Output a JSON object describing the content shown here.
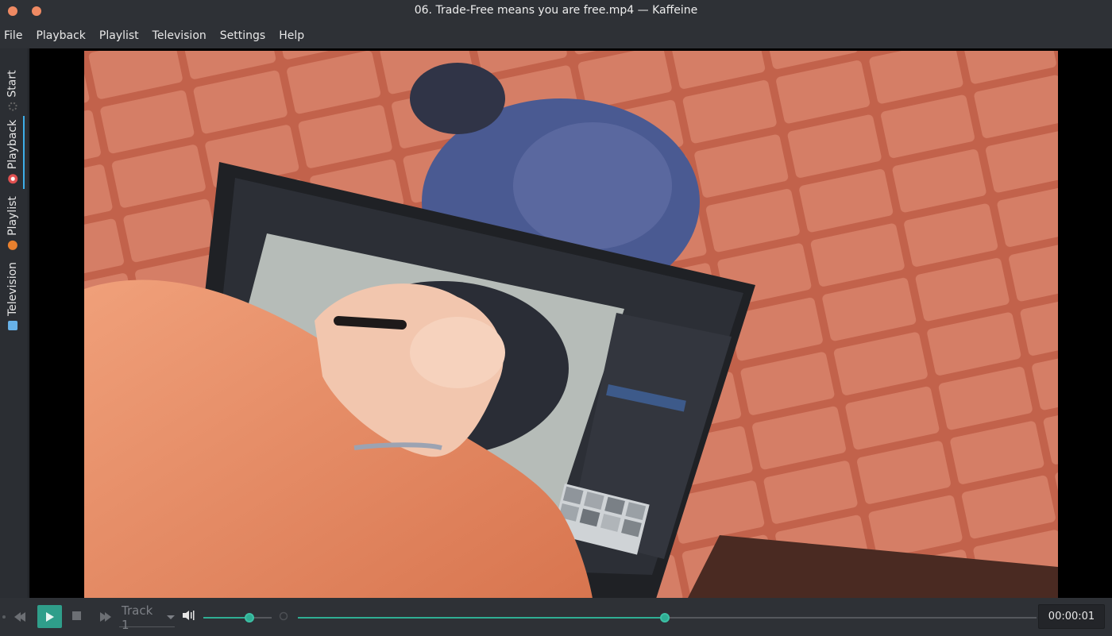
{
  "window": {
    "title": "06. Trade-Free means you are free.mp4 — Kaffeine"
  },
  "menu": {
    "items": [
      "File",
      "Playback",
      "Playlist",
      "Television",
      "Settings",
      "Help"
    ]
  },
  "sidebar": {
    "tabs": [
      {
        "label": "Start",
        "icon": "start-icon",
        "active": false
      },
      {
        "label": "Playback",
        "icon": "playback-icon",
        "active": true
      },
      {
        "label": "Playlist",
        "icon": "playlist-icon",
        "active": false
      },
      {
        "label": "Television",
        "icon": "television-icon",
        "active": false
      }
    ]
  },
  "controls": {
    "track_label": "Track 1",
    "volume_fraction": 0.68,
    "seek_fraction": 0.497,
    "time": "00:00:01"
  },
  "colors": {
    "accent": "#2fae94",
    "play_button": "#2f9e8a",
    "window_button": "#ef8a63",
    "background": "#2e3136"
  }
}
